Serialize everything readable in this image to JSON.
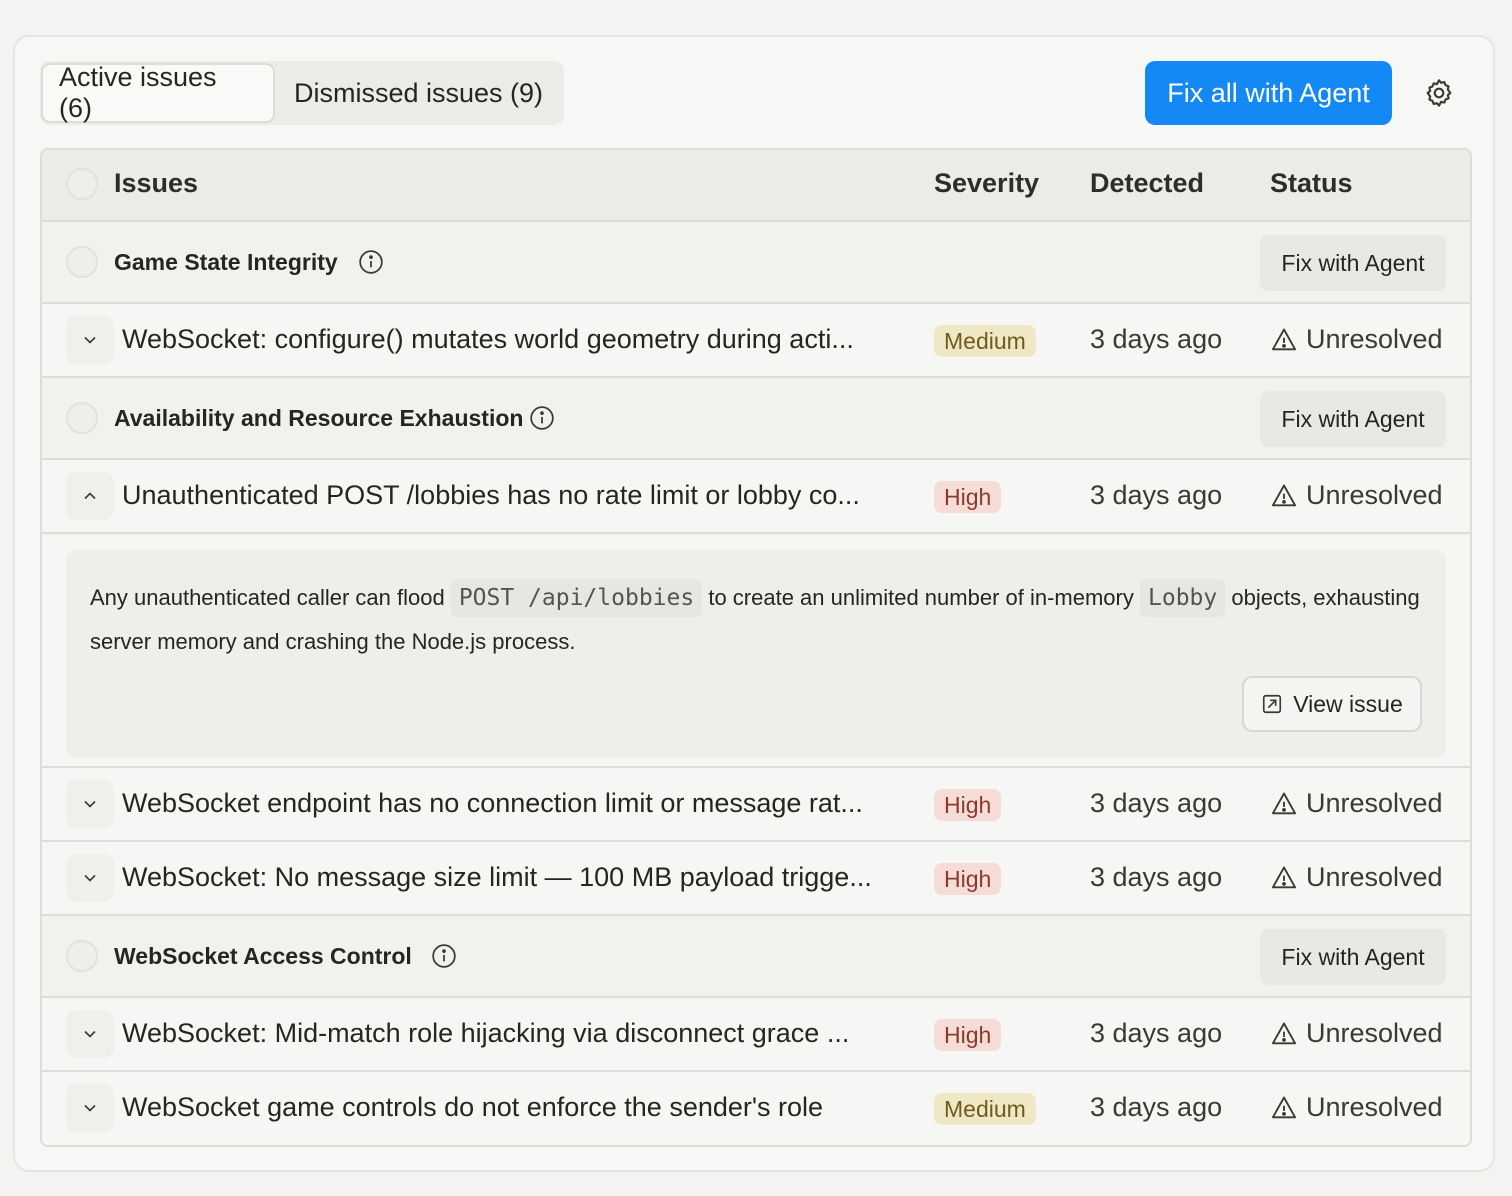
{
  "tabs": {
    "active": "Active issues (6)",
    "dismissed": "Dismissed issues (9)"
  },
  "actions": {
    "fix_all": "Fix all with Agent",
    "settings_icon": "gear-icon"
  },
  "table": {
    "headers": {
      "issues": "Issues",
      "severity": "Severity",
      "detected": "Detected",
      "status": "Status"
    },
    "fix_label": "Fix with Agent",
    "groups": [
      {
        "title": "Game State Integrity",
        "issues": [
          {
            "title": "WebSocket: configure() mutates world geometry during acti...",
            "severity": "Medium",
            "detected": "3 days ago",
            "status": "Unresolved",
            "expanded": false
          }
        ]
      },
      {
        "title": "Availability and Resource Exhaustion",
        "issues": [
          {
            "title": "Unauthenticated POST /lobbies has no rate limit or lobby co...",
            "severity": "High",
            "detected": "3 days ago",
            "status": "Unresolved",
            "expanded": true
          },
          {
            "title": "WebSocket endpoint has no connection limit or message rat...",
            "severity": "High",
            "detected": "3 days ago",
            "status": "Unresolved",
            "expanded": false
          },
          {
            "title": "WebSocket: No message size limit — 100 MB payload trigge...",
            "severity": "High",
            "detected": "3 days ago",
            "status": "Unresolved",
            "expanded": false
          }
        ]
      },
      {
        "title": "WebSocket Access Control",
        "issues": [
          {
            "title": "WebSocket: Mid-match role hijacking via disconnect grace ...",
            "severity": "High",
            "detected": "3 days ago",
            "status": "Unresolved",
            "expanded": false
          },
          {
            "title": "WebSocket game controls do not enforce the sender's role",
            "severity": "Medium",
            "detected": "3 days ago",
            "status": "Unresolved",
            "expanded": false
          }
        ]
      }
    ]
  },
  "expanded_detail": {
    "text_1": "Any unauthenticated caller can flood",
    "code_1": "POST /api/lobbies",
    "text_2": "to create an unlimited number of in-memory",
    "code_2": "Lobby",
    "text_3": "objects, exhausting server memory and crashing the Node.js process.",
    "view_label": "View issue"
  },
  "colors": {
    "accent": "#1488f5",
    "medium_badge": "#f0e7c4",
    "high_badge": "#f6dcd6"
  }
}
